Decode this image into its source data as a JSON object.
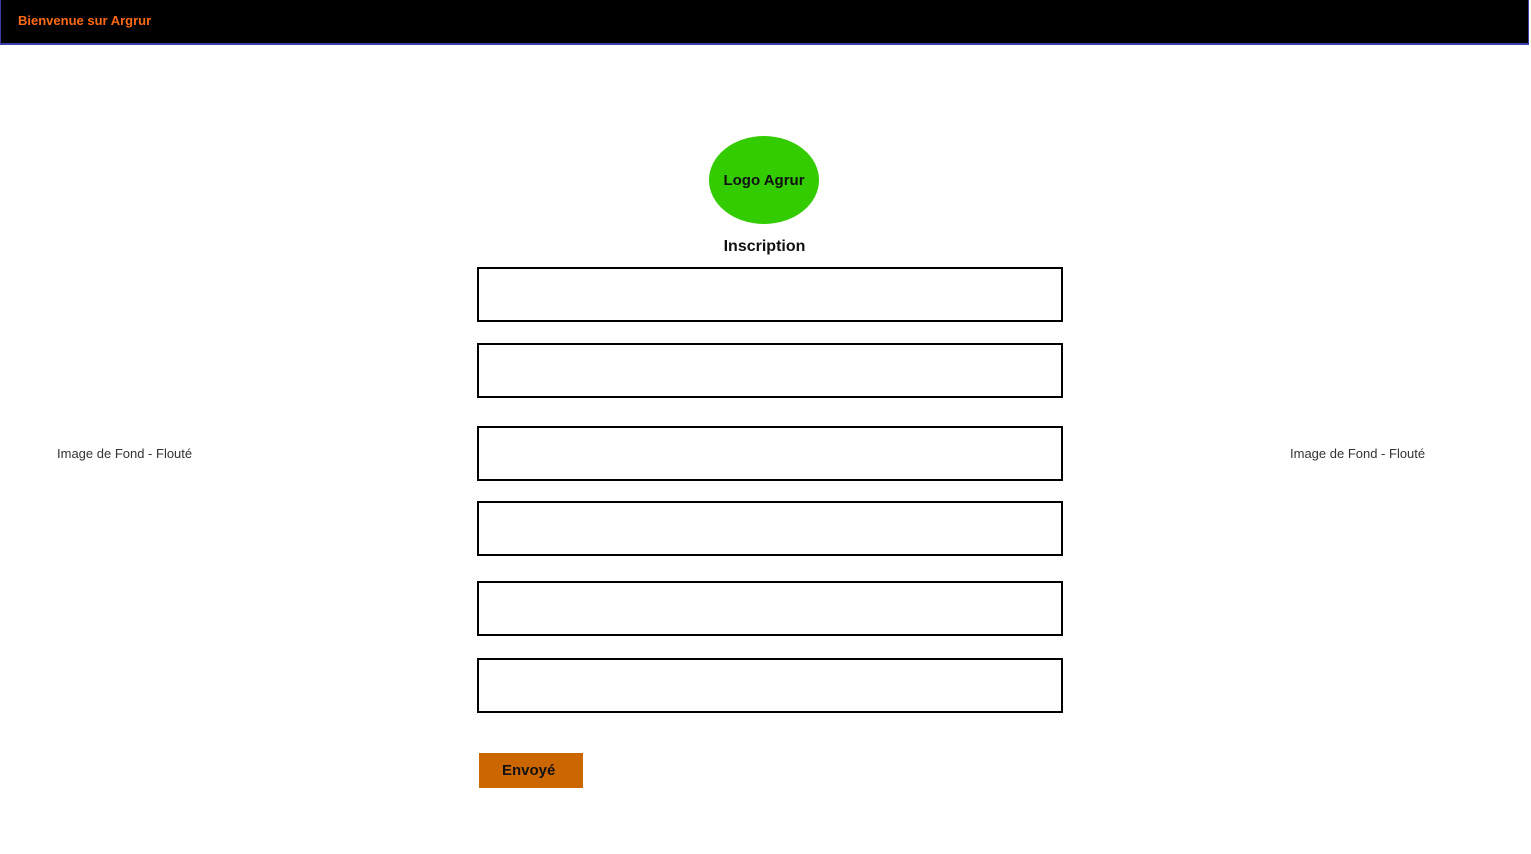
{
  "header": {
    "title": "Bienvenue sur Argrur"
  },
  "logo": {
    "text": "Logo Agrur"
  },
  "form": {
    "title": "Inscription",
    "fields": [
      {
        "value": "",
        "placeholder": ""
      },
      {
        "value": "",
        "placeholder": ""
      },
      {
        "value": "",
        "placeholder": ""
      },
      {
        "value": "",
        "placeholder": ""
      },
      {
        "value": "",
        "placeholder": ""
      },
      {
        "value": "",
        "placeholder": ""
      }
    ],
    "submit_label": "Envoyé"
  },
  "background": {
    "left_label": "Image de Fond - Flouté",
    "right_label": "Image de Fond - Flouté"
  },
  "colors": {
    "header_bg": "#000000",
    "header_text": "#ff6a13",
    "logo_bg": "#33cc00",
    "button_bg": "#cc6600"
  }
}
